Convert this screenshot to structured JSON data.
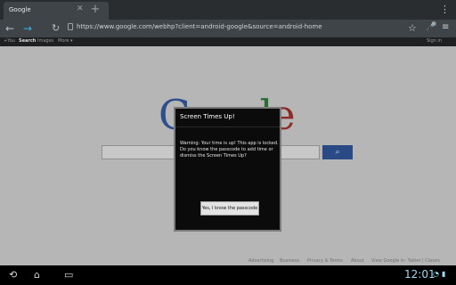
{
  "browser": {
    "tab": {
      "title": "Google"
    },
    "new_tab_symbol": "+",
    "url": "https://www.google.com/webhp?client=android-google&source=android-home"
  },
  "gbar": {
    "items": [
      {
        "label": "+You"
      },
      {
        "label": "Search"
      },
      {
        "label": "Images"
      },
      {
        "label": "More ▾"
      }
    ],
    "signin": "Sign in"
  },
  "google_logo": {
    "text": "Google"
  },
  "footer": {
    "links": [
      {
        "label": "Advertising"
      },
      {
        "label": "Business"
      },
      {
        "label": "Privacy & Terms"
      },
      {
        "label": "About"
      },
      {
        "label": "View Google in: Tablet | Classic"
      }
    ]
  },
  "dialog": {
    "title": "Screen Times Up!",
    "message": "Warning: Your time is up! This app is locked. Do you know the passcode to add time or dismiss the Screen Times Up?",
    "button_label": "Yes, I know the passcode"
  },
  "system_bar": {
    "time": "12:01",
    "icons": [
      "back-icon",
      "home-icon",
      "recent-apps-icon"
    ],
    "status_icons": [
      "wifi-icon",
      "battery-icon"
    ]
  }
}
